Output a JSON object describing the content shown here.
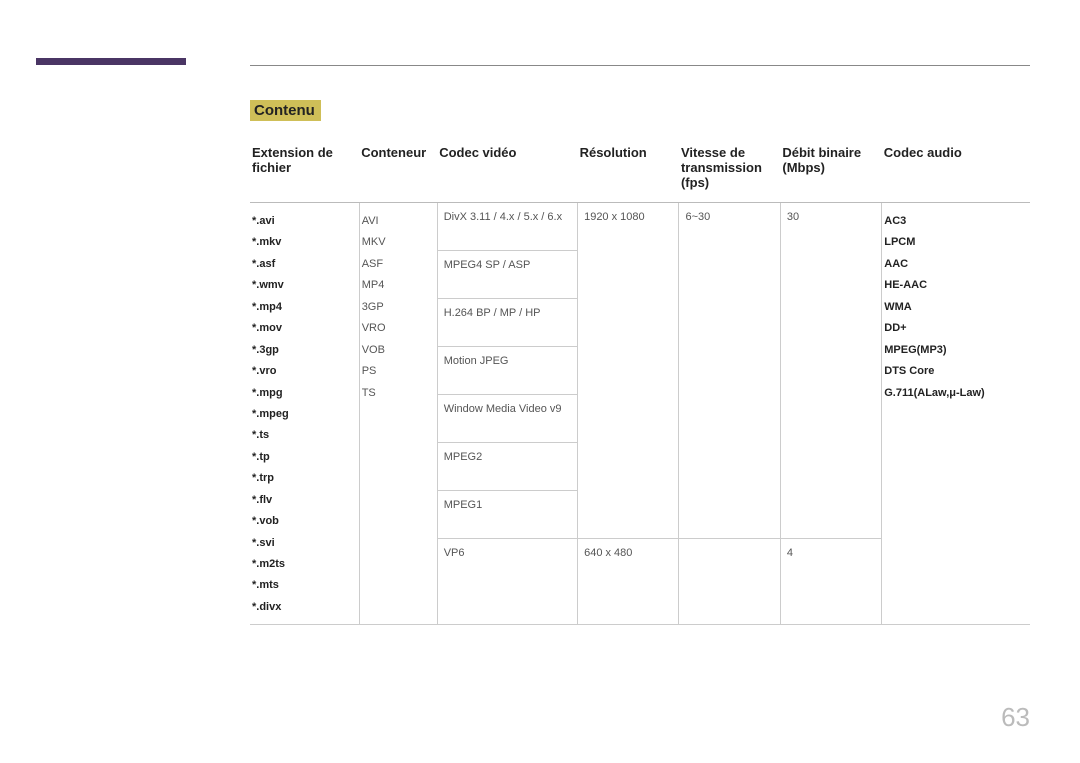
{
  "section_title": "Contenu",
  "headers": {
    "ext": "Extension de fichier",
    "container": "Conteneur",
    "vcodec": "Codec vidéo",
    "resolution": "Résolution",
    "fps": "Vitesse de transmission (fps)",
    "bitrate": "Débit binaire (Mbps)",
    "acodec": "Codec audio"
  },
  "extensions": [
    "*.avi",
    "*.mkv",
    "*.asf",
    "*.wmv",
    "*.mp4",
    "*.mov",
    "*.3gp",
    "*.vro",
    "*.mpg",
    "*.mpeg",
    "*.ts",
    "*.tp",
    "*.trp",
    "*.flv",
    "*.vob",
    "*.svi",
    "*.m2ts",
    "*.mts",
    "*.divx"
  ],
  "containers": [
    "AVI",
    "MKV",
    "ASF",
    "MP4",
    "3GP",
    "VRO",
    "VOB",
    "PS",
    "TS"
  ],
  "video_codecs_top": [
    "DivX 3.11 / 4.x / 5.x / 6.x",
    "MPEG4 SP / ASP",
    "H.264 BP / MP / HP",
    "Motion JPEG",
    "Window Media Video v9",
    "MPEG2",
    "MPEG1"
  ],
  "video_codecs_bottom": "VP6",
  "resolution_top": "1920 x 1080",
  "resolution_bottom": "640 x 480",
  "fps_top": "6~30",
  "fps_bottom": "",
  "bitrate_top": "30",
  "bitrate_bottom": "4",
  "audio_codecs": [
    "AC3",
    "LPCM",
    "AAC",
    "HE-AAC",
    "WMA",
    "DD+",
    "MPEG(MP3)",
    "DTS Core",
    "G.711(ALaw,μ-Law)"
  ],
  "page_number": "63"
}
